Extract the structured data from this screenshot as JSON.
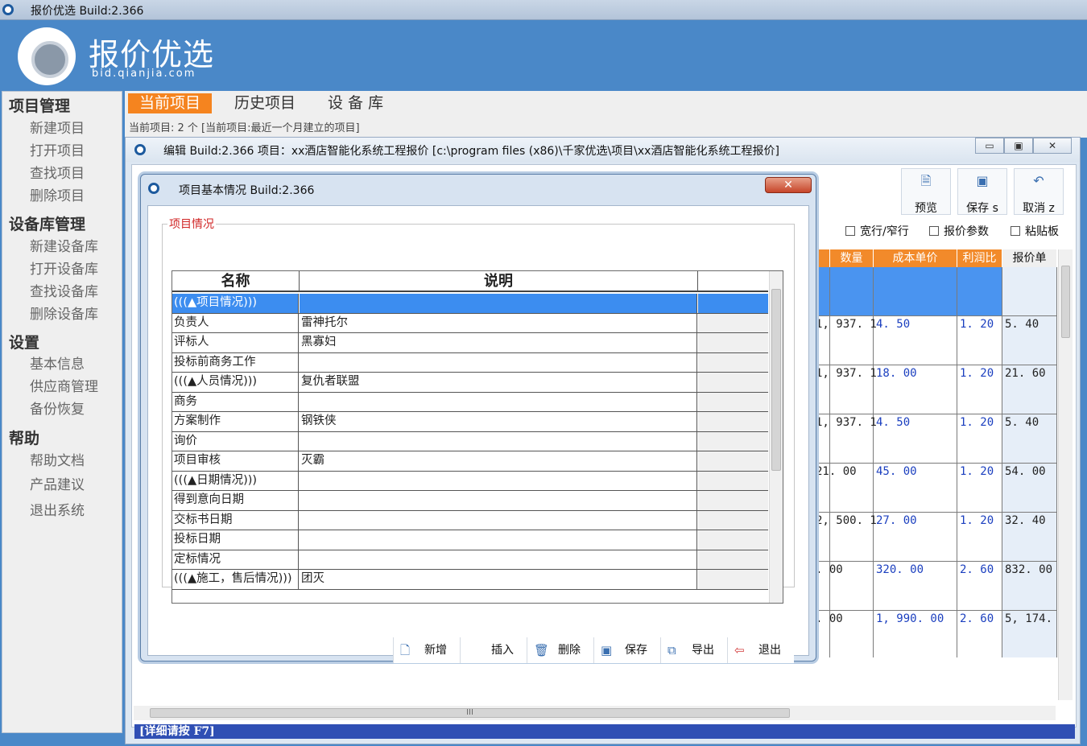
{
  "os_title": "报价优选   Build:2.366",
  "header": {
    "logo_title": "报价优选",
    "logo_sub": "bid.qianjia.com"
  },
  "sidebar": {
    "sections": [
      {
        "title": "项目管理",
        "items": [
          "新建项目",
          "打开项目",
          "查找项目",
          "删除项目"
        ]
      },
      {
        "title": "设备库管理",
        "items": [
          "新建设备库",
          "打开设备库",
          "查找设备库",
          "删除设备库"
        ]
      },
      {
        "title": "设置",
        "items": [
          "基本信息",
          "供应商管理",
          "备份恢复"
        ]
      },
      {
        "title": "帮助",
        "items": [
          "帮助文档",
          "产品建议",
          "退出系统"
        ]
      }
    ]
  },
  "tabs": [
    {
      "label": "当前项目",
      "active": true
    },
    {
      "label": "历史项目",
      "active": false
    },
    {
      "label": "设 备 库",
      "active": false
    }
  ],
  "current_info": "当前项目: 2 个     [当前项目:最近一个月建立的项目]",
  "editor": {
    "title": "编辑   Build:2.366    项目：xx酒店智能化系统工程报价     [c:\\program files (x86)\\千家优选\\项目\\xx酒店智能化系统工程报价]",
    "win_buttons": [
      "▭",
      "▣",
      "✕"
    ],
    "toolbar": [
      {
        "label": "预览",
        "icon": "preview-icon"
      },
      {
        "label": "保存 s",
        "icon": "save-icon"
      },
      {
        "label": "取消 z",
        "icon": "undo-icon"
      }
    ],
    "checkboxes": [
      "宽行/窄行",
      "报价参数",
      "粘贴板"
    ],
    "grid_headers": [
      "数量",
      "成本单价",
      "利润比",
      "报价单"
    ],
    "grid_rows": [
      [
        "1, 937. 1",
        "4. 50",
        "1. 20",
        "5. 40"
      ],
      [
        "1, 937. 1",
        "18. 00",
        "1. 20",
        "21. 60"
      ],
      [
        "1, 937. 1",
        "4. 50",
        "1. 20",
        "5. 40"
      ],
      [
        "21. 00",
        "45. 00",
        "1. 20",
        "54. 00"
      ],
      [
        "2, 500. 1",
        "27. 00",
        "1. 20",
        "32. 40"
      ],
      [
        ". 00",
        "320. 00",
        "2. 60",
        "832. 00"
      ],
      [
        ". 00",
        "1, 990. 00",
        "2. 60",
        "5, 174. 00"
      ]
    ],
    "scroll_mark": "III"
  },
  "statusbar": "[详细请按 F7]",
  "dialog": {
    "title": "项目基本情况   Build:2.366",
    "close_label": "✕",
    "group_label": "项目情况",
    "columns": [
      "名称",
      "说明"
    ],
    "rows": [
      {
        "name": "(((▲项目情况)))",
        "desc": "",
        "selected": true
      },
      {
        "name": "负责人",
        "desc": "雷神托尔"
      },
      {
        "name": "评标人",
        "desc": "黑寡妇"
      },
      {
        "name": "投标前商务工作",
        "desc": ""
      },
      {
        "name": "(((▲人员情况)))",
        "desc": "复仇者联盟"
      },
      {
        "name": "商务",
        "desc": ""
      },
      {
        "name": "方案制作",
        "desc": "钢铁侠"
      },
      {
        "name": "询价",
        "desc": ""
      },
      {
        "name": "项目审核",
        "desc": "灭霸"
      },
      {
        "name": "(((▲日期情况)))",
        "desc": ""
      },
      {
        "name": "得到意向日期",
        "desc": ""
      },
      {
        "name": "交标书日期",
        "desc": ""
      },
      {
        "name": "投标日期",
        "desc": ""
      },
      {
        "name": "定标情况",
        "desc": ""
      },
      {
        "name": "(((▲施工，售后情况)))",
        "desc": "团灭"
      }
    ],
    "buttons": [
      {
        "label": "新增",
        "icon": "document-icon"
      },
      {
        "label": "插入",
        "icon": ""
      },
      {
        "label": "删除",
        "icon": "trash-icon"
      },
      {
        "label": "保存",
        "icon": "save-icon"
      },
      {
        "label": "导出",
        "icon": "copy-icon"
      },
      {
        "label": "退出",
        "icon": "exit-icon"
      }
    ]
  }
}
